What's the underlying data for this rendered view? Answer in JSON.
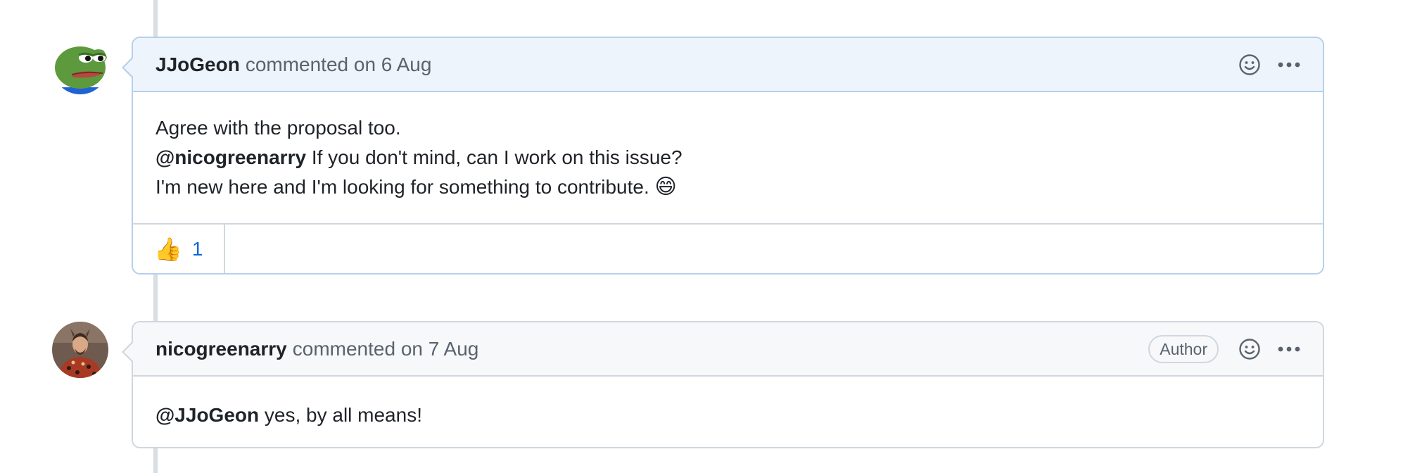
{
  "comments": [
    {
      "author": "JJoGeon",
      "meta": "commented on 6 Aug",
      "body": {
        "line1": "Agree with the proposal too.",
        "line2_mention": "@nicogreenarry",
        "line2_text": " If you don't mind, can I work on this issue?",
        "line3_text": "I'm new here and I'm looking for something to contribute. ",
        "line3_emoji": "😄"
      },
      "reactions": [
        {
          "emoji": "👍",
          "count": "1"
        }
      ]
    },
    {
      "author": "nicogreenarry",
      "meta": "commented on 7 Aug",
      "badge": "Author",
      "body": {
        "mention": "@JJoGeon",
        "text": " yes, by all means!"
      }
    }
  ],
  "colors": {
    "highlight_header": "#eef4fc",
    "highlight_border": "#b6cfec",
    "default_header": "#f6f8fa",
    "border": "#d0d7de",
    "link": "#0969da"
  },
  "icons": {
    "reaction_add": "smiley-icon",
    "more_actions": "kebab-horizontal-icon"
  }
}
